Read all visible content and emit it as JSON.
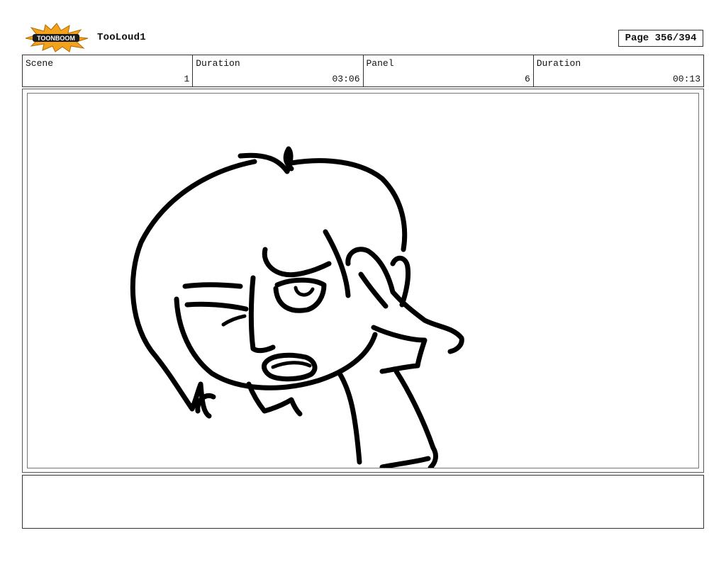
{
  "header": {
    "logo_text": "TOONBOOM",
    "project_title": "TooLoud1",
    "page_label": "Page 356/394"
  },
  "info": [
    {
      "label": "Scene",
      "value": "1"
    },
    {
      "label": "Duration",
      "value": "03:06"
    },
    {
      "label": "Panel",
      "value": "6"
    },
    {
      "label": "Duration",
      "value": "00:13"
    }
  ],
  "panel": {
    "drawing": "character-holding-head-sketch"
  },
  "notes": {
    "text": ""
  },
  "colors": {
    "logo_burst": "#f4a11c",
    "logo_text": "#1a1a1a",
    "border": "#333333"
  }
}
